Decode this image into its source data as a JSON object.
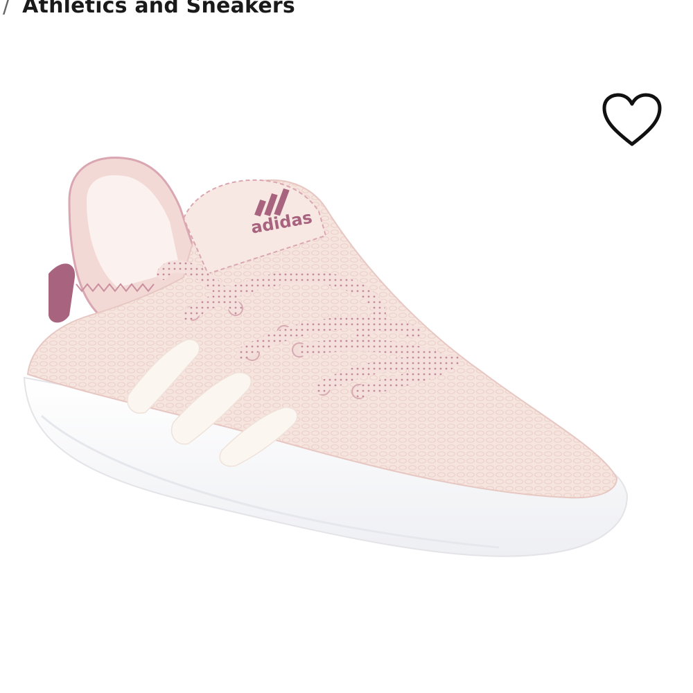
{
  "breadcrumb": {
    "separator": "/",
    "current": "Athletics and Sneakers"
  },
  "product": {
    "brand_logo_text": "adidas",
    "image_icon": "sneaker-product-image",
    "colors": {
      "upper": "#f6e3de",
      "accent": "#a8647f",
      "sole": "#ffffff",
      "stripes": "#fbf7f2"
    }
  },
  "wishlist": {
    "icon": "heart-outline-icon"
  }
}
